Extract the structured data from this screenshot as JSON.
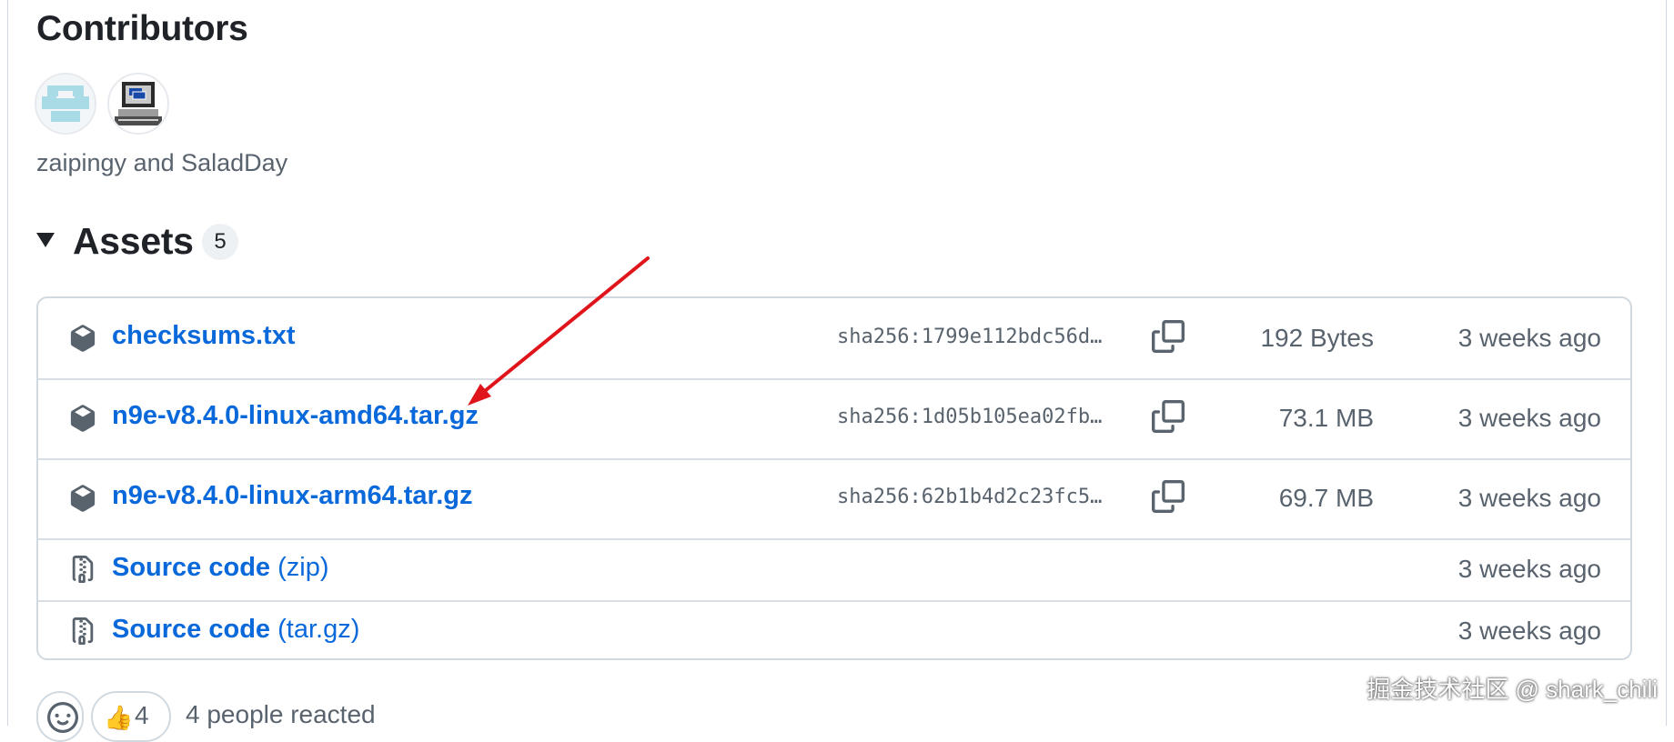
{
  "contributors": {
    "title": "Contributors",
    "names_text": "zaipingy and SaladDay",
    "avatars": [
      "zaipingy",
      "SaladDay"
    ]
  },
  "assets": {
    "title": "Assets",
    "count": "5",
    "items": [
      {
        "name": "checksums.txt",
        "sub": "",
        "sha": "sha256:1799e112bdc56d…",
        "size": "192 Bytes",
        "time": "3 weeks ago",
        "icon": "package-icon"
      },
      {
        "name": "n9e-v8.4.0-linux-amd64.tar.gz",
        "sub": "",
        "sha": "sha256:1d05b105ea02fb…",
        "size": "73.1 MB",
        "time": "3 weeks ago",
        "icon": "package-icon"
      },
      {
        "name": "n9e-v8.4.0-linux-arm64.tar.gz",
        "sub": "",
        "sha": "sha256:62b1b4d2c23fc5…",
        "size": "69.7 MB",
        "time": "3 weeks ago",
        "icon": "package-icon"
      },
      {
        "name": "Source code",
        "sub": " (zip)",
        "sha": "",
        "size": "",
        "time": "3 weeks ago",
        "icon": "file-zip-icon"
      },
      {
        "name": "Source code",
        "sub": " (tar.gz)",
        "sha": "",
        "size": "",
        "time": "3 weeks ago",
        "icon": "file-zip-icon"
      }
    ]
  },
  "reactions": {
    "thumbs_count": "4",
    "text": "4 people reacted"
  },
  "watermark": "掘金技术社区 @ shark_chili",
  "colors": {
    "link": "#0969da",
    "muted": "#59636e",
    "arrow": "#e0151b"
  }
}
